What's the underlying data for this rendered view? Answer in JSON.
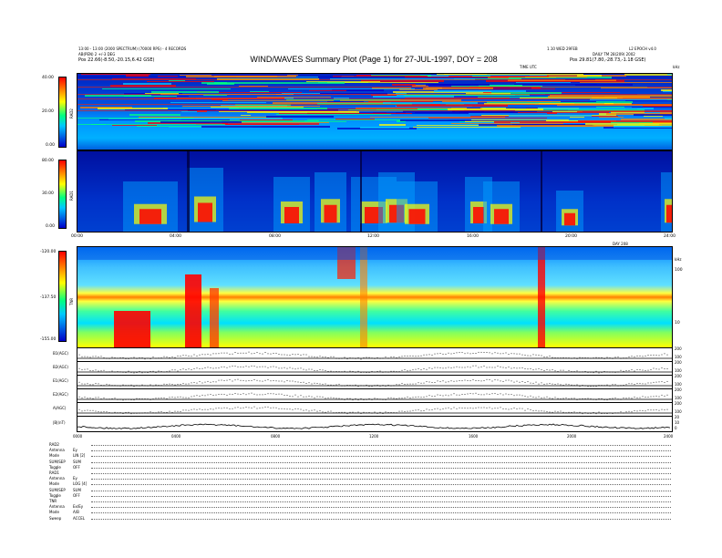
{
  "header": {
    "title": "WIND/WAVES Summary Plot (Page 1) for 27-JUL-1997, DOY = 208",
    "left_line1": "13:00 - 13:00 (2000 SPECTRUM) (70000 RPS) - 4 RECORDS",
    "left_line2": "AB(PEN) 2 +/-3 DEG",
    "left_line3": "Pos 22.66(-8.50,-20.15,6.42 GSE)",
    "right_line1": "1.10 WED 29FEB",
    "right_line2": "L2 EPOCH v4.0",
    "right_line3": "DAILY TM 28(209) 2002",
    "right_line4": "Pos 29.81(7.80,-28.73,-1.18 GSE)",
    "rad2_right_label": "TIME UTC",
    "rad2_right_unit": "kHz"
  },
  "panels": {
    "rad2": {
      "name": "RAD2",
      "ticks": [
        "40.00",
        "20.00",
        "0.00"
      ]
    },
    "rad1": {
      "name": "RAD1",
      "ticks": [
        "80.00",
        "30.00",
        "0.00"
      ]
    },
    "tnr": {
      "name": "TNR",
      "ticks": [
        "-120.00",
        "-137.50",
        "-155.00"
      ],
      "right_ticks": [
        "100",
        "10"
      ],
      "right_unit": "kHz"
    },
    "time_axis_1": [
      "00:00",
      "04:00",
      "08:00",
      "12:00",
      "16:00",
      "20:00",
      "24:00"
    ],
    "date_label": "DAY 208",
    "time_axis_2": [
      "0000",
      "0400",
      "0800",
      "1200",
      "1600",
      "2000",
      "2400"
    ]
  },
  "mag_panels": [
    {
      "label": "B1(AGC)",
      "ticks": [
        "200",
        "100"
      ]
    },
    {
      "label": "B2(AGC)",
      "ticks": [
        "200",
        "100"
      ]
    },
    {
      "label": "E1(AGC)",
      "ticks": [
        "200",
        "100"
      ]
    },
    {
      "label": "E2(AGC)",
      "ticks": [
        "200",
        "100"
      ]
    },
    {
      "label": "A(AGC)",
      "ticks": [
        "200",
        "100"
      ]
    },
    {
      "label": "|B|(nT)",
      "ticks": [
        "20",
        "10",
        "0"
      ]
    }
  ],
  "settings": [
    {
      "name": "RAD2",
      "value": ""
    },
    {
      "name": "Antenna",
      "value": "Ey"
    },
    {
      "name": "Mode",
      "value": "LIN [2]"
    },
    {
      "name": "SUM/SEP",
      "value": "SUM"
    },
    {
      "name": "Toggle",
      "value": "OFF"
    },
    {
      "name": "RAD1",
      "value": ""
    },
    {
      "name": "Antenna",
      "value": "Ey"
    },
    {
      "name": "Mode",
      "value": "LOG [4]"
    },
    {
      "name": "SUM/SEP",
      "value": "SUM"
    },
    {
      "name": "Toggle",
      "value": "OFF"
    },
    {
      "name": "TNR",
      "value": ""
    },
    {
      "name": "Antenna",
      "value": "Ex/Ey"
    },
    {
      "name": "Mode",
      "value": "A/B"
    },
    {
      "name": "Sweep",
      "value": "ACCEL"
    }
  ],
  "colors": {
    "low": "#0000c8",
    "mid1": "#00c8ff",
    "mid2": "#ffff00",
    "high": "#ff0000"
  }
}
